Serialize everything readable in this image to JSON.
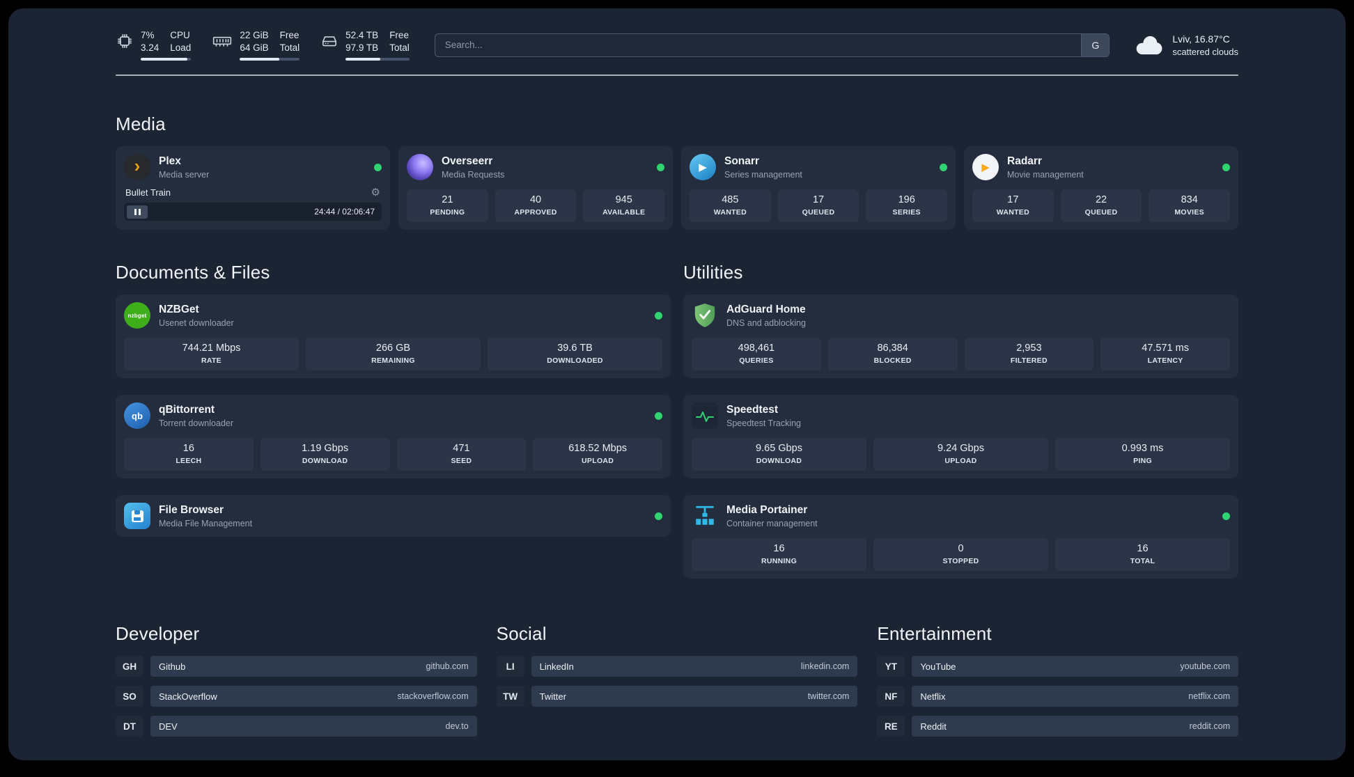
{
  "topbar": {
    "cpu": {
      "value1": "7%",
      "value2": "3.24",
      "label1": "CPU",
      "label2": "Load",
      "progress": 93
    },
    "ram": {
      "value1": "22 GiB",
      "value2": "64 GiB",
      "label1": "Free",
      "label2": "Total",
      "progress": 66
    },
    "disk": {
      "value1": "52.4 TB",
      "value2": "97.9 TB",
      "label1": "Free",
      "label2": "Total",
      "progress": 54
    },
    "search": {
      "placeholder": "Search...",
      "button": "G"
    },
    "weather": {
      "location": "Lviv, 16.87°C",
      "condition": "scattered clouds"
    }
  },
  "sections": {
    "media": {
      "title": "Media"
    },
    "documents": {
      "title": "Documents & Files"
    },
    "utilities": {
      "title": "Utilities"
    },
    "developer": {
      "title": "Developer"
    },
    "social": {
      "title": "Social"
    },
    "entertainment": {
      "title": "Entertainment"
    }
  },
  "apps": {
    "plex": {
      "name": "Plex",
      "desc": "Media server",
      "status": "online",
      "player": {
        "title": "Bullet Train",
        "time": "24:44 / 02:06:47"
      }
    },
    "overseerr": {
      "name": "Overseerr",
      "desc": "Media Requests",
      "status": "online",
      "stats": [
        {
          "value": "21",
          "label": "PENDING"
        },
        {
          "value": "40",
          "label": "APPROVED"
        },
        {
          "value": "945",
          "label": "AVAILABLE"
        }
      ]
    },
    "sonarr": {
      "name": "Sonarr",
      "desc": "Series management",
      "status": "online",
      "stats": [
        {
          "value": "485",
          "label": "WANTED"
        },
        {
          "value": "17",
          "label": "QUEUED"
        },
        {
          "value": "196",
          "label": "SERIES"
        }
      ]
    },
    "radarr": {
      "name": "Radarr",
      "desc": "Movie management",
      "status": "online",
      "stats": [
        {
          "value": "17",
          "label": "WANTED"
        },
        {
          "value": "22",
          "label": "QUEUED"
        },
        {
          "value": "834",
          "label": "MOVIES"
        }
      ]
    },
    "nzbget": {
      "name": "NZBGet",
      "desc": "Usenet downloader",
      "status": "online",
      "stats": [
        {
          "value": "744.21 Mbps",
          "label": "RATE"
        },
        {
          "value": "266 GB",
          "label": "REMAINING"
        },
        {
          "value": "39.6 TB",
          "label": "DOWNLOADED"
        }
      ]
    },
    "qbittorrent": {
      "name": "qBittorrent",
      "desc": "Torrent downloader",
      "status": "online",
      "stats": [
        {
          "value": "16",
          "label": "LEECH"
        },
        {
          "value": "1.19 Gbps",
          "label": "DOWNLOAD"
        },
        {
          "value": "471",
          "label": "SEED"
        },
        {
          "value": "618.52 Mbps",
          "label": "UPLOAD"
        }
      ]
    },
    "filebrowser": {
      "name": "File Browser",
      "desc": "Media File Management",
      "status": "online"
    },
    "adguard": {
      "name": "AdGuard Home",
      "desc": "DNS and adblocking",
      "stats": [
        {
          "value": "498,461",
          "label": "QUERIES"
        },
        {
          "value": "86,384",
          "label": "BLOCKED"
        },
        {
          "value": "2,953",
          "label": "FILTERED"
        },
        {
          "value": "47.571 ms",
          "label": "LATENCY"
        }
      ]
    },
    "speedtest": {
      "name": "Speedtest",
      "desc": "Speedtest Tracking",
      "stats": [
        {
          "value": "9.65 Gbps",
          "label": "DOWNLOAD"
        },
        {
          "value": "9.24 Gbps",
          "label": "UPLOAD"
        },
        {
          "value": "0.993 ms",
          "label": "PING"
        }
      ]
    },
    "portainer": {
      "name": "Media Portainer",
      "desc": "Container management",
      "status": "online",
      "stats": [
        {
          "value": "16",
          "label": "RUNNING"
        },
        {
          "value": "0",
          "label": "STOPPED"
        },
        {
          "value": "16",
          "label": "TOTAL"
        }
      ]
    }
  },
  "links": {
    "developer": [
      {
        "abbr": "GH",
        "name": "Github",
        "url": "github.com"
      },
      {
        "abbr": "SO",
        "name": "StackOverflow",
        "url": "stackoverflow.com"
      },
      {
        "abbr": "DT",
        "name": "DEV",
        "url": "dev.to"
      }
    ],
    "social": [
      {
        "abbr": "LI",
        "name": "LinkedIn",
        "url": "linkedin.com"
      },
      {
        "abbr": "TW",
        "name": "Twitter",
        "url": "twitter.com"
      }
    ],
    "entertainment": [
      {
        "abbr": "YT",
        "name": "YouTube",
        "url": "youtube.com"
      },
      {
        "abbr": "NF",
        "name": "Netflix",
        "url": "netflix.com"
      },
      {
        "abbr": "RE",
        "name": "Reddit",
        "url": "reddit.com"
      }
    ]
  },
  "icons": {
    "plex_glyph": "›",
    "play_glyph": "▶",
    "gear_glyph": "⚙",
    "qbittorrent_label": "qb",
    "nzbget_label": "nzbget"
  },
  "colors": {
    "status_online": "#2fd36f",
    "accent_green": "#2fd36f"
  }
}
